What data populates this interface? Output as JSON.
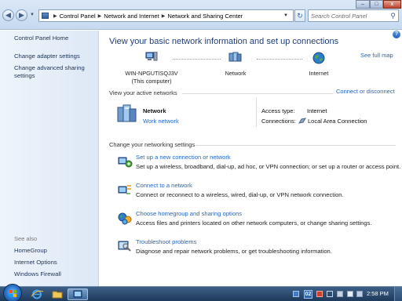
{
  "window": {
    "breadcrumb": [
      "Control Panel",
      "Network and Internet",
      "Network and Sharing Center"
    ],
    "search_placeholder": "Search Control Panel",
    "controls": {
      "minimize": "–",
      "maximize": "□",
      "close": "x"
    }
  },
  "sidebar": {
    "items": [
      {
        "label": "Control Panel Home"
      },
      {
        "label": "Change adapter settings"
      },
      {
        "label": "Change advanced sharing settings"
      }
    ],
    "see_also_heading": "See also",
    "see_also": [
      {
        "label": "HomeGroup"
      },
      {
        "label": "Internet Options"
      },
      {
        "label": "Windows Firewall"
      }
    ]
  },
  "main": {
    "title": "View your basic network information and set up connections",
    "see_full_map": "See full map",
    "map": {
      "computer_name": "WIN-NPGUTISQJ3V",
      "computer_caption": "(This computer)",
      "network": "Network",
      "internet": "Internet"
    },
    "active_networks_heading": "View your active networks",
    "connect_disconnect": "Connect or disconnect",
    "active_network": {
      "name": "Network",
      "type": "Work network",
      "access_type_label": "Access type:",
      "access_type_value": "Internet",
      "connections_label": "Connections:",
      "connections_value": "Local Area Connection"
    },
    "settings_heading": "Change your networking settings",
    "tasks": [
      {
        "title": "Set up a new connection or network",
        "desc": "Set up a wireless, broadband, dial-up, ad hoc, or VPN connection; or set up a router or access point.",
        "icon": "new-connection-icon"
      },
      {
        "title": "Connect to a network",
        "desc": "Connect or reconnect to a wireless, wired, dial-up, or VPN network connection.",
        "icon": "connect-network-icon"
      },
      {
        "title": "Choose homegroup and sharing options",
        "desc": "Access files and printers located on other network computers, or change sharing settings.",
        "icon": "homegroup-icon"
      },
      {
        "title": "Troubleshoot problems",
        "desc": "Diagnose and repair network problems, or get troubleshooting information.",
        "icon": "troubleshoot-icon"
      }
    ]
  },
  "taskbar": {
    "language": "02",
    "time": "2:58 PM"
  },
  "colors": {
    "link": "#2566c1",
    "title": "#1f3e7f",
    "taskbar": "#1e3a5c"
  }
}
